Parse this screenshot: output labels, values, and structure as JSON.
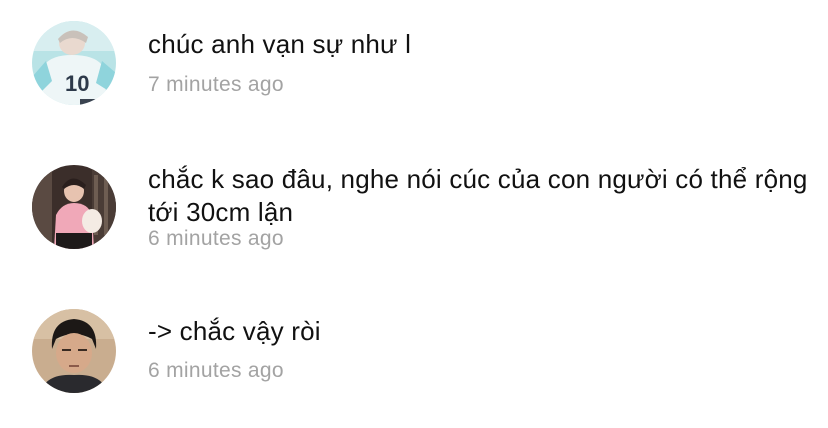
{
  "comments": [
    {
      "text": "chúc anh vạn sự như l",
      "time": "7 minutes ago",
      "avatar_icon": "user-avatar-jersey-10"
    },
    {
      "text": "chắc k sao đâu, nghe nói cúc của con người có thể rộng tới 30cm lận",
      "time": "6 minutes ago",
      "avatar_icon": "user-avatar-pink-outfit"
    },
    {
      "text": "-> chắc vậy ròi",
      "time": "6 minutes ago",
      "avatar_icon": "user-avatar-selfie"
    }
  ],
  "colors": {
    "comment_text": "#111111",
    "timestamp": "#a3a3a3",
    "background": "#ffffff"
  }
}
